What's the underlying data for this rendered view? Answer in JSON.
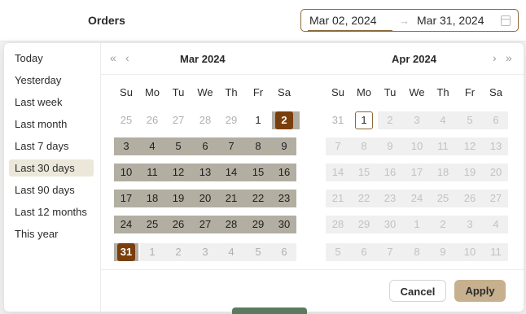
{
  "header": {
    "title": "Orders"
  },
  "date_range": {
    "start": "Mar 02, 2024",
    "end": "Mar 31, 2024",
    "separator": "→"
  },
  "presets": [
    "Today",
    "Yesterday",
    "Last week",
    "Last month",
    "Last 7 days",
    "Last 30 days",
    "Last 90 days",
    "Last 12 months",
    "This year"
  ],
  "active_preset": "Last 30 days",
  "weekdays": [
    "Su",
    "Mo",
    "Tu",
    "We",
    "Th",
    "Fr",
    "Sa"
  ],
  "calendars": [
    {
      "month_label": "Mar  2024",
      "weeks": [
        [
          {
            "d": "25",
            "kind": "other"
          },
          {
            "d": "26",
            "kind": "other"
          },
          {
            "d": "27",
            "kind": "other"
          },
          {
            "d": "28",
            "kind": "other"
          },
          {
            "d": "29",
            "kind": "other"
          },
          {
            "d": "1",
            "kind": "cur"
          },
          {
            "d": "2",
            "kind": "start"
          }
        ],
        [
          {
            "d": "3",
            "kind": "inrange"
          },
          {
            "d": "4",
            "kind": "inrange"
          },
          {
            "d": "5",
            "kind": "inrange"
          },
          {
            "d": "6",
            "kind": "inrange"
          },
          {
            "d": "7",
            "kind": "inrange"
          },
          {
            "d": "8",
            "kind": "inrange"
          },
          {
            "d": "9",
            "kind": "inrange"
          }
        ],
        [
          {
            "d": "10",
            "kind": "inrange"
          },
          {
            "d": "11",
            "kind": "inrange"
          },
          {
            "d": "12",
            "kind": "inrange"
          },
          {
            "d": "13",
            "kind": "inrange"
          },
          {
            "d": "14",
            "kind": "inrange"
          },
          {
            "d": "15",
            "kind": "inrange"
          },
          {
            "d": "16",
            "kind": "inrange"
          }
        ],
        [
          {
            "d": "17",
            "kind": "inrange"
          },
          {
            "d": "18",
            "kind": "inrange"
          },
          {
            "d": "19",
            "kind": "inrange"
          },
          {
            "d": "20",
            "kind": "inrange"
          },
          {
            "d": "21",
            "kind": "inrange"
          },
          {
            "d": "22",
            "kind": "inrange"
          },
          {
            "d": "23",
            "kind": "inrange"
          }
        ],
        [
          {
            "d": "24",
            "kind": "inrange"
          },
          {
            "d": "25",
            "kind": "inrange"
          },
          {
            "d": "26",
            "kind": "inrange"
          },
          {
            "d": "27",
            "kind": "inrange"
          },
          {
            "d": "28",
            "kind": "inrange"
          },
          {
            "d": "29",
            "kind": "inrange"
          },
          {
            "d": "30",
            "kind": "inrange"
          }
        ],
        [
          {
            "d": "31",
            "kind": "end"
          },
          {
            "d": "1",
            "kind": "other"
          },
          {
            "d": "2",
            "kind": "other"
          },
          {
            "d": "3",
            "kind": "other"
          },
          {
            "d": "4",
            "kind": "other"
          },
          {
            "d": "5",
            "kind": "other"
          },
          {
            "d": "6",
            "kind": "other"
          }
        ]
      ]
    },
    {
      "month_label": "Apr  2024",
      "weeks": [
        [
          {
            "d": "31",
            "kind": "other"
          },
          {
            "d": "1",
            "kind": "today"
          },
          {
            "d": "2",
            "kind": "muted"
          },
          {
            "d": "3",
            "kind": "muted"
          },
          {
            "d": "4",
            "kind": "muted"
          },
          {
            "d": "5",
            "kind": "muted"
          },
          {
            "d": "6",
            "kind": "muted"
          }
        ],
        [
          {
            "d": "7",
            "kind": "muted"
          },
          {
            "d": "8",
            "kind": "muted"
          },
          {
            "d": "9",
            "kind": "muted"
          },
          {
            "d": "10",
            "kind": "muted"
          },
          {
            "d": "11",
            "kind": "muted"
          },
          {
            "d": "12",
            "kind": "muted"
          },
          {
            "d": "13",
            "kind": "muted"
          }
        ],
        [
          {
            "d": "14",
            "kind": "muted"
          },
          {
            "d": "15",
            "kind": "muted"
          },
          {
            "d": "16",
            "kind": "muted"
          },
          {
            "d": "17",
            "kind": "muted"
          },
          {
            "d": "18",
            "kind": "muted"
          },
          {
            "d": "19",
            "kind": "muted"
          },
          {
            "d": "20",
            "kind": "muted"
          }
        ],
        [
          {
            "d": "21",
            "kind": "muted"
          },
          {
            "d": "22",
            "kind": "muted"
          },
          {
            "d": "23",
            "kind": "muted"
          },
          {
            "d": "24",
            "kind": "muted"
          },
          {
            "d": "25",
            "kind": "muted"
          },
          {
            "d": "26",
            "kind": "muted"
          },
          {
            "d": "27",
            "kind": "muted"
          }
        ],
        [
          {
            "d": "28",
            "kind": "muted"
          },
          {
            "d": "29",
            "kind": "muted"
          },
          {
            "d": "30",
            "kind": "muted"
          },
          {
            "d": "1",
            "kind": "muted"
          },
          {
            "d": "2",
            "kind": "muted"
          },
          {
            "d": "3",
            "kind": "muted"
          },
          {
            "d": "4",
            "kind": "muted"
          }
        ],
        [
          {
            "d": "5",
            "kind": "muted"
          },
          {
            "d": "6",
            "kind": "muted"
          },
          {
            "d": "7",
            "kind": "muted"
          },
          {
            "d": "8",
            "kind": "muted"
          },
          {
            "d": "9",
            "kind": "muted"
          },
          {
            "d": "10",
            "kind": "muted"
          },
          {
            "d": "11",
            "kind": "muted"
          }
        ]
      ]
    }
  ],
  "buttons": {
    "cancel": "Cancel",
    "apply": "Apply"
  },
  "icons": {
    "prev_year": "double-chevron-left-icon",
    "prev_month": "chevron-left-icon",
    "next_month": "chevron-right-icon",
    "next_year": "double-chevron-right-icon",
    "calendar": "calendar-icon"
  },
  "colors": {
    "accent": "#7a3e0c",
    "range_fill": "#b2aea2",
    "apply_button": "#c7b08e",
    "input_border": "#8a6a3a",
    "preset_active": "#ebe8da"
  }
}
